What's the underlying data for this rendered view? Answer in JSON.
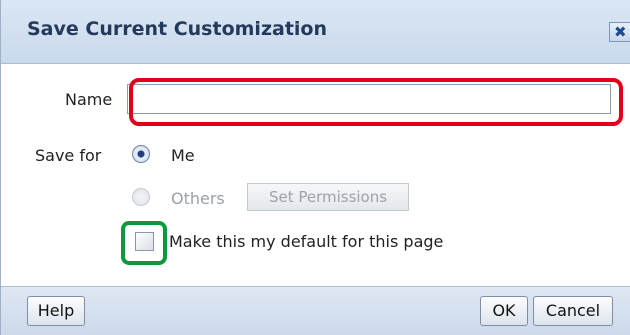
{
  "dialog": {
    "title": "Save Current Customization",
    "close_glyph": "✖"
  },
  "form": {
    "name_label": "Name",
    "name_value": "",
    "save_for_label": "Save for",
    "options": [
      {
        "label": "Me",
        "selected": true,
        "enabled": true
      },
      {
        "label": "Others",
        "selected": false,
        "enabled": false
      }
    ],
    "set_permissions_label": "Set Permissions",
    "default_checkbox_label": "Make this my default for this page",
    "default_checked": false
  },
  "footer": {
    "help_label": "Help",
    "ok_label": "OK",
    "cancel_label": "Cancel"
  },
  "colors": {
    "highlight_red": "#e3001b",
    "highlight_green": "#0a9a3c",
    "title_bar": "#c9d9ec"
  }
}
